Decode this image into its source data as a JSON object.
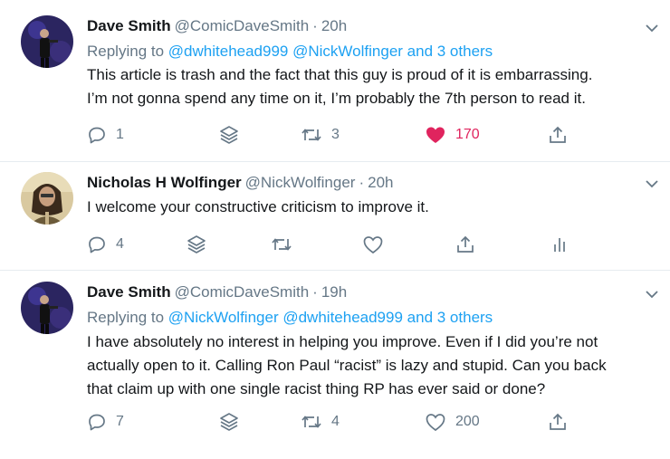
{
  "colors": {
    "accent": "#1da1f2",
    "muted": "#657786",
    "like": "#e0245e",
    "text": "#14171a",
    "divider": "#e6ecf0"
  },
  "tweets": [
    {
      "name": "Dave Smith",
      "handle": "@ComicDaveSmith",
      "separator": "·",
      "time": "20h",
      "reply_prefix": "Replying to",
      "mentions": [
        "@dwhitehead999",
        "@NickWolfinger",
        "and 3 others"
      ],
      "lines": [
        "This article is trash and the fact that this guy is proud of it is embarrassing.",
        "I’m not gonna spend any time on it, I’m probably the 7th person to read it."
      ],
      "replies": "1",
      "retweets": "3",
      "likes": "170",
      "liked": true
    },
    {
      "name": "Nicholas H Wolfinger",
      "handle": "@NickWolfinger",
      "separator": "·",
      "time": "20h",
      "lines": [
        "I welcome your constructive criticism to improve it."
      ],
      "replies": "4",
      "retweets": "",
      "likes": ""
    },
    {
      "name": "Dave Smith",
      "handle": "@ComicDaveSmith",
      "separator": "·",
      "time": "19h",
      "reply_prefix": "Replying to",
      "mentions": [
        "@NickWolfinger",
        "@dwhitehead999",
        "and 3 others"
      ],
      "lines": [
        "I have absolutely no interest in helping you improve. Even if I did you’re not",
        "actually open to it. Calling Ron Paul “racist” is lazy and stupid. Can you back",
        "that claim up with one single racist thing RP has ever said or done?"
      ],
      "replies": "7",
      "retweets": "4",
      "likes": "200"
    }
  ]
}
